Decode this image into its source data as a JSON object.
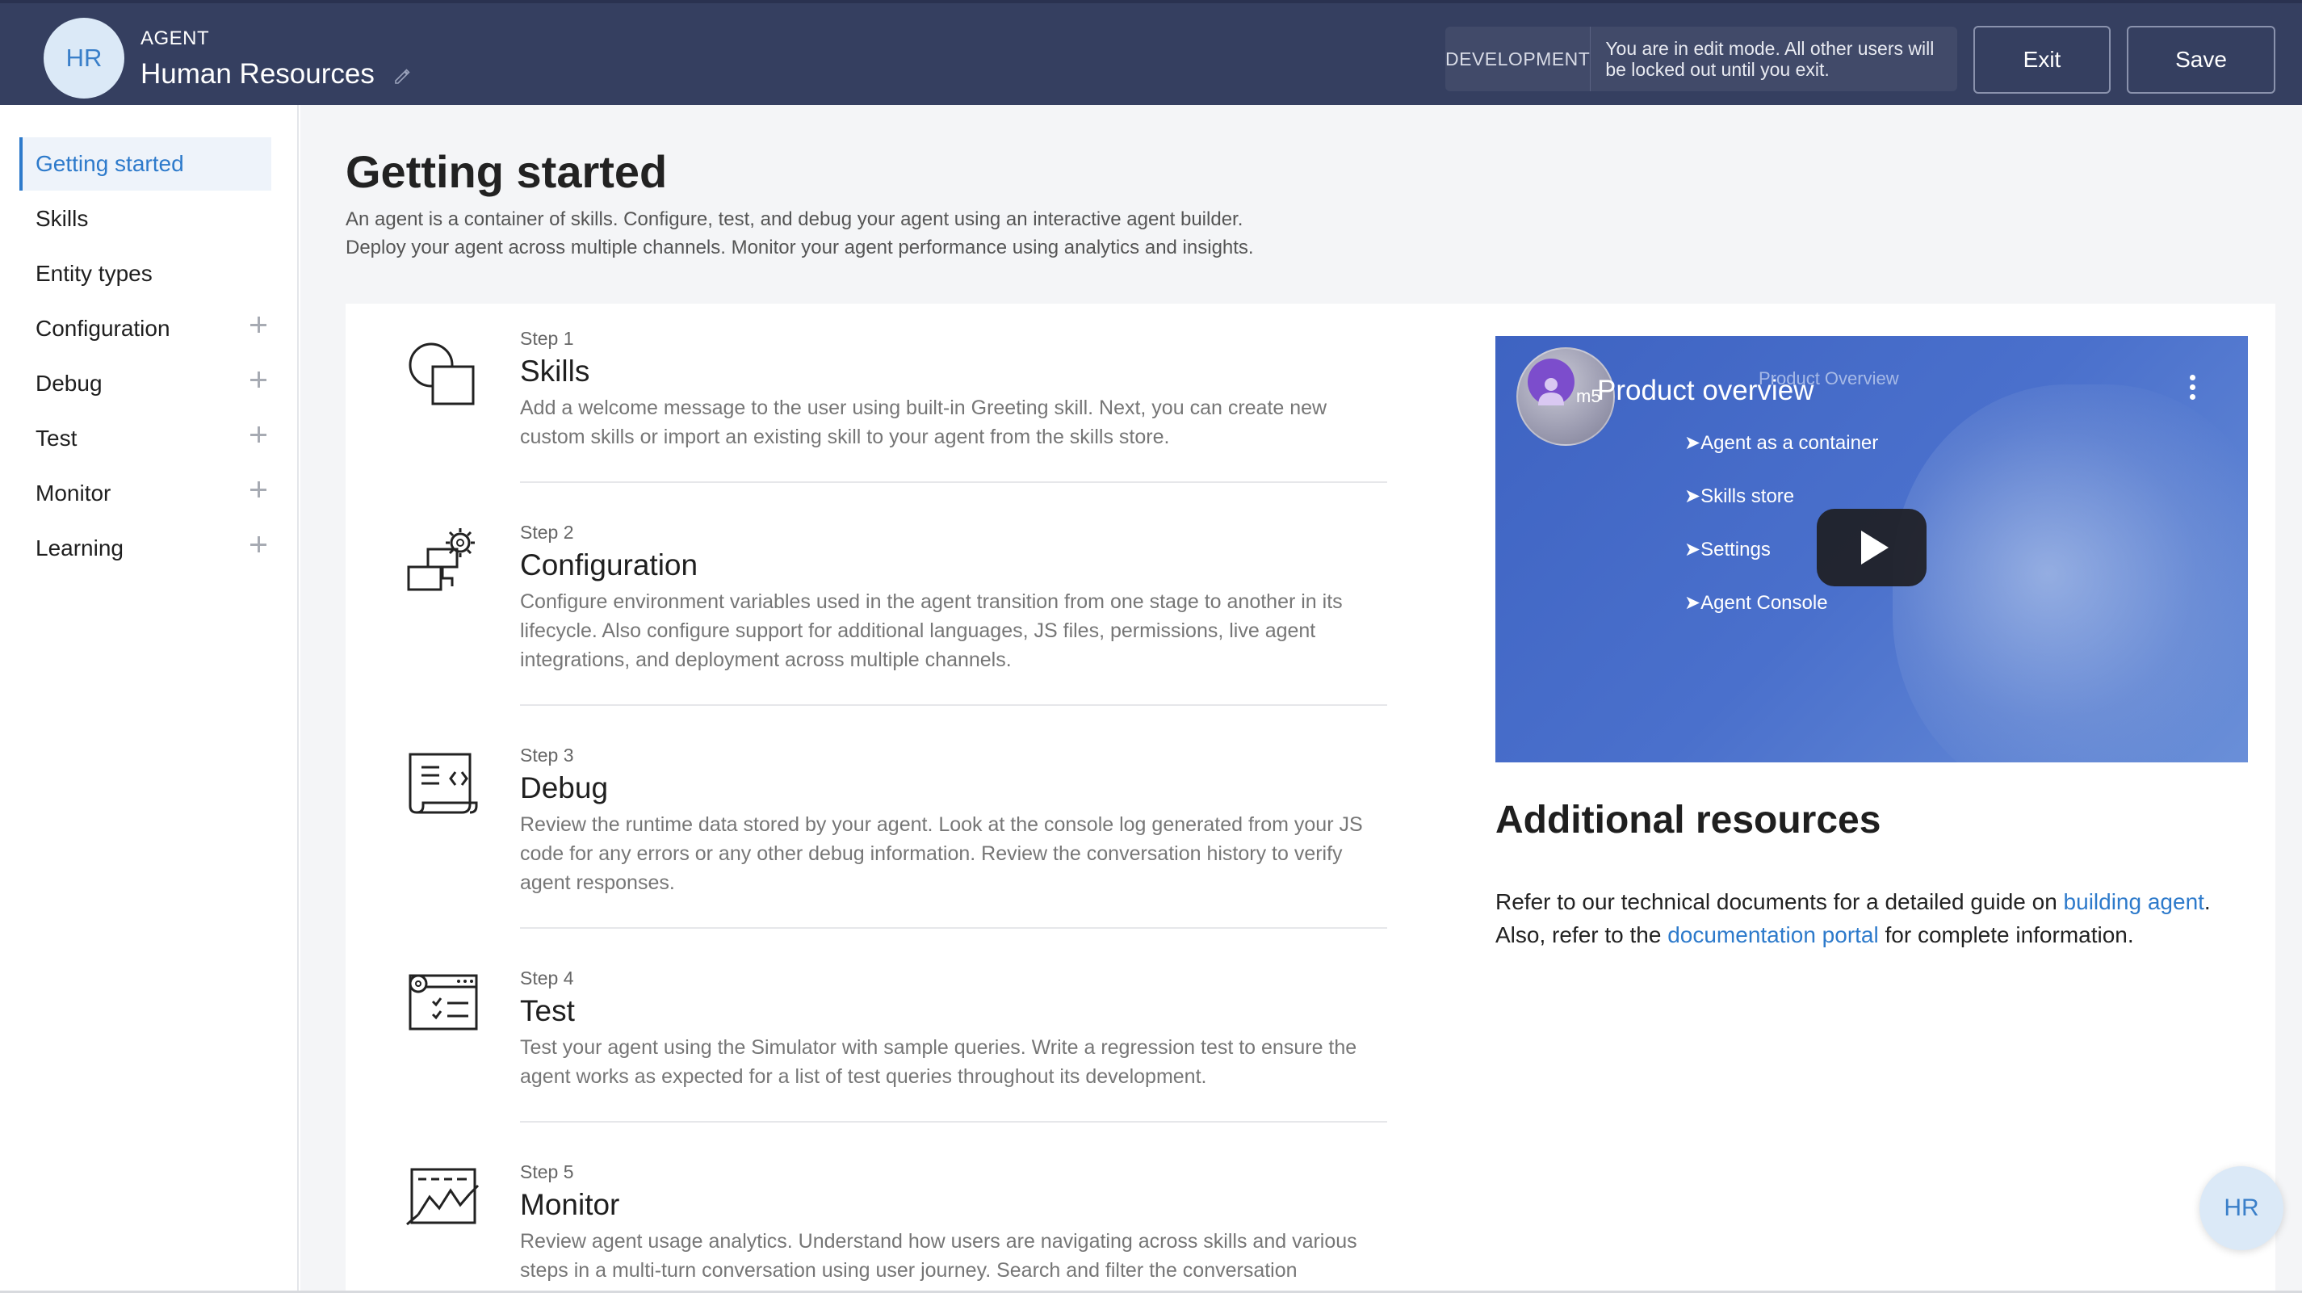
{
  "header": {
    "avatar_initials": "HR",
    "agent_label": "AGENT",
    "agent_name": "Human Resources",
    "environment": "DEVELOPMENT",
    "edit_message": "You are in edit mode. All other users will be locked out until you exit.",
    "exit_label": "Exit",
    "save_label": "Save"
  },
  "sidebar": {
    "items": [
      {
        "label": "Getting started",
        "active": true,
        "expandable": false
      },
      {
        "label": "Skills",
        "active": false,
        "expandable": false
      },
      {
        "label": "Entity types",
        "active": false,
        "expandable": false
      },
      {
        "label": "Configuration",
        "active": false,
        "expandable": true
      },
      {
        "label": "Debug",
        "active": false,
        "expandable": true
      },
      {
        "label": "Test",
        "active": false,
        "expandable": true
      },
      {
        "label": "Monitor",
        "active": false,
        "expandable": true
      },
      {
        "label": "Learning",
        "active": false,
        "expandable": true
      }
    ]
  },
  "main": {
    "title": "Getting started",
    "description_line1": "An agent is a container of skills. Configure, test, and debug your agent using an interactive agent builder.",
    "description_line2": "Deploy your agent across multiple channels. Monitor your agent performance using analytics and insights.",
    "steps": [
      {
        "number": "Step 1",
        "title": "Skills",
        "text": "Add a welcome message to the user using built-in Greeting skill. Next, you can create new custom skills or import an existing skill to your agent from the skills store.",
        "icon": "skills-icon"
      },
      {
        "number": "Step 2",
        "title": "Configuration",
        "text": "Configure environment variables used in the agent transition from one stage to another in its lifecycle. Also configure support for additional languages, JS files, permissions, live agent integrations, and deployment across multiple channels.",
        "icon": "configuration-icon"
      },
      {
        "number": "Step 3",
        "title": "Debug",
        "text": "Review the runtime data stored by your agent. Look at the console log generated from your JS code for any errors or any other debug information. Review the conversation history to verify agent responses.",
        "icon": "debug-icon"
      },
      {
        "number": "Step 4",
        "title": "Test",
        "text": "Test your agent using the Simulator with sample queries. Write a regression test to ensure the agent works as expected for a list of test queries throughout its development.",
        "icon": "test-icon"
      },
      {
        "number": "Step 5",
        "title": "Monitor",
        "text": "Review agent usage analytics. Understand how users are navigating across skills and various steps in a multi-turn conversation using user journey. Search and filter the conversation",
        "icon": "monitor-icon"
      }
    ]
  },
  "video": {
    "title": "Product overview",
    "ghost_title": "Product Overview",
    "avatar_text": "m5",
    "items": [
      "➤Agent as a container",
      "➤Skills store",
      "➤Settings",
      "➤Agent Console"
    ]
  },
  "resources": {
    "title": "Additional resources",
    "text_1": "Refer to our technical documents for a detailed guide on ",
    "link_1": "building agent",
    "text_2": ".",
    "text_3": "Also, refer to the ",
    "link_2": "documentation portal",
    "text_4": " for complete information."
  },
  "fab": {
    "initials": "HR"
  }
}
